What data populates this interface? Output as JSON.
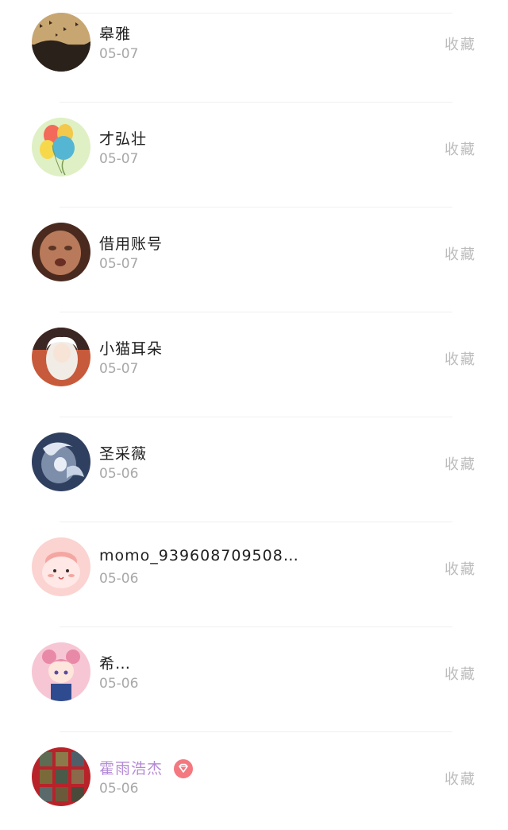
{
  "items": [
    {
      "name": "皋雅",
      "date": "05-07",
      "action": "收藏"
    },
    {
      "name": "才弘壮",
      "date": "05-07",
      "action": "收藏"
    },
    {
      "name": "借用账号",
      "date": "05-07",
      "action": "收藏"
    },
    {
      "name": "小猫耳朵",
      "date": "05-07",
      "action": "收藏"
    },
    {
      "name": "圣采薇",
      "date": "05-06",
      "action": "收藏"
    },
    {
      "name": "momo_939608709508…",
      "date": "05-06",
      "action": "收藏"
    },
    {
      "name": "希…",
      "date": "05-06",
      "action": "收藏"
    },
    {
      "name": "霍雨浩杰",
      "date": "05-06",
      "action": "收藏",
      "vip": true
    }
  ],
  "colors": {
    "name_text": "#1f1f1f",
    "vip_name_text": "#b48ad6",
    "date_text": "#a8a8a8",
    "action_text": "#bcbcbc",
    "vip_badge": "#f3787f"
  }
}
